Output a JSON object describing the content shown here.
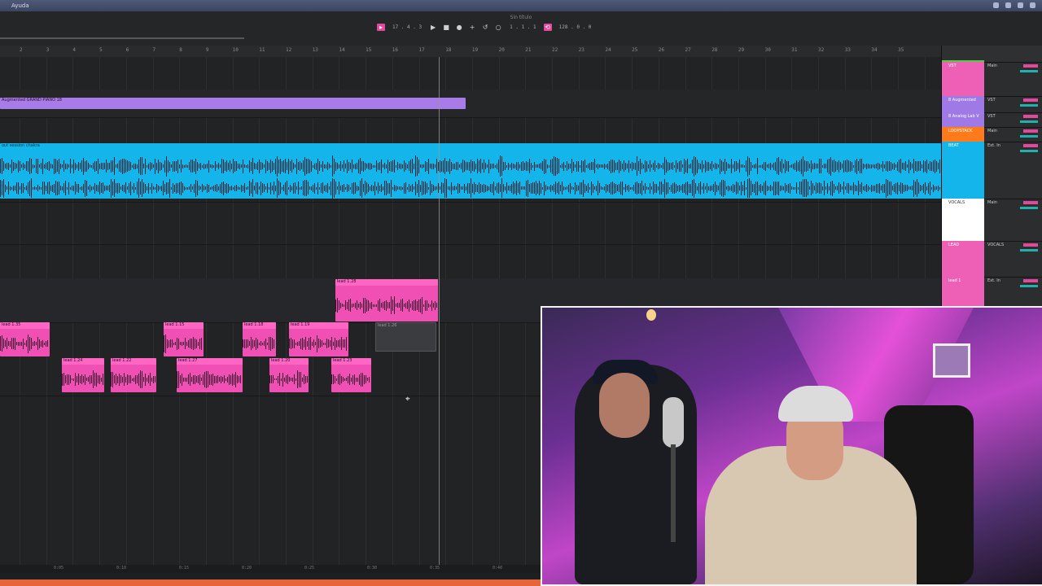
{
  "menubar": {
    "app_name": "Ayuda"
  },
  "transport": {
    "song_title": "Sin título",
    "position": "17 . 4 . 3",
    "loop_start": "1 . 1 . 1",
    "tempo": "128 . 0 . 0"
  },
  "ruler": {
    "bars": [
      "2",
      "3",
      "4",
      "5",
      "6",
      "7",
      "8",
      "9",
      "10",
      "11",
      "12",
      "13",
      "14",
      "15",
      "16",
      "17",
      "18",
      "19",
      "20",
      "21",
      "22",
      "23",
      "24",
      "25",
      "26",
      "27",
      "28",
      "29",
      "30",
      "31",
      "32",
      "33",
      "34",
      "35"
    ]
  },
  "time_ruler": [
    "0:05",
    "0:10",
    "0:15",
    "0:20",
    "0:25",
    "0:30",
    "0:35",
    "0:40"
  ],
  "arrangement": {
    "piano_lane_label": "Augmented GRAND PIANO 18",
    "vocal_clip_label": "out session chakra",
    "lead_clips": [
      "lead 1.28",
      "lead 1.35",
      "lead 1.15",
      "lead 1.18",
      "lead 1.19",
      "lead 1.26",
      "lead 1.24",
      "lead 1.22",
      "lead 1.27",
      "lead 1.20",
      "lead 1.23"
    ]
  },
  "tracks": [
    {
      "name": "VST",
      "route": "Main",
      "color": "#ee60b6"
    },
    {
      "name": "8 Augmented",
      "route": "VST",
      "color": "#9f7ae6"
    },
    {
      "name": "8 Analog Lab V",
      "route": "VST",
      "color": "#9f7ae6"
    },
    {
      "name": "LOOPSTACK",
      "route": "Main",
      "color": "#ff7a1a"
    },
    {
      "name": "BEAT",
      "route": "Ext. In",
      "color": "#13b5ea"
    },
    {
      "name": "VOCALS",
      "route": "Main",
      "color": "#ffffff"
    },
    {
      "name": "LEAD",
      "route": "VOCALS",
      "color": "#ee60b6"
    },
    {
      "name": "lead 1",
      "route": "Ext. In",
      "color": "#ee60b6"
    }
  ],
  "colors": {
    "pink": "#f050b4",
    "purple": "#a77ce8",
    "blue": "#13b5ea",
    "accent": "#e3489d"
  }
}
